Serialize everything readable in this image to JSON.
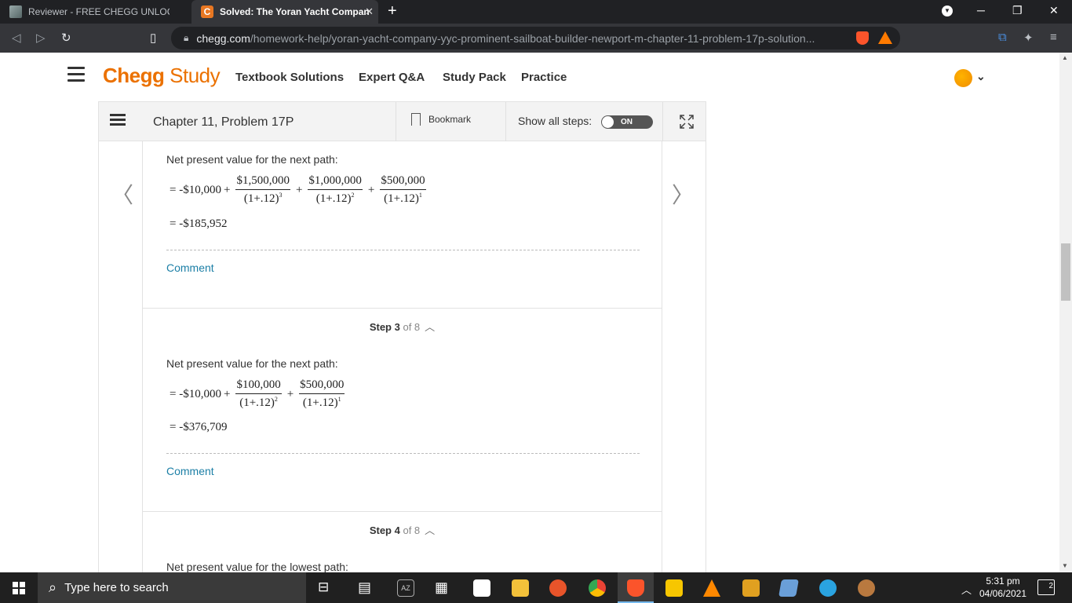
{
  "browser": {
    "tabs": [
      {
        "title": "Reviewer - FREE CHEGG UNLOCKS | Pa",
        "active": false
      },
      {
        "title": "Solved: The Yoran Yacht Company",
        "active": true
      }
    ],
    "url_host": "chegg.com",
    "url_path": "/homework-help/yoran-yacht-company-yyc-prominent-sailboat-builder-newport-m-chapter-11-problem-17p-solution..."
  },
  "header": {
    "logo_main": "Chegg",
    "logo_sub": "Study",
    "nav": [
      "Textbook Solutions",
      "Expert Q&A",
      "Study Pack",
      "Practice"
    ]
  },
  "panel": {
    "chapter_title": "Chapter 11, Problem 17P",
    "bookmark_label": "Bookmark",
    "show_steps_label": "Show all steps:",
    "toggle_label": "ON"
  },
  "steps": {
    "s2": {
      "text": "Net present value for the next path:",
      "lead": "= -$10,000",
      "fracs": [
        {
          "num": "$1,500,000",
          "den": "(1+.12)",
          "exp": "3"
        },
        {
          "num": "$1,000,000",
          "den": "(1+.12)",
          "exp": "2"
        },
        {
          "num": "$500,000",
          "den": "(1+.12)",
          "exp": "1"
        }
      ],
      "result": "= -$185,952",
      "comment": "Comment"
    },
    "s3": {
      "label": "Step 3",
      "of": "of 8",
      "text": "Net present value for the next path:",
      "lead": "= -$10,000",
      "fracs": [
        {
          "num": "$100,000",
          "den": "(1+.12)",
          "exp": "2"
        },
        {
          "num": "$500,000",
          "den": "(1+.12)",
          "exp": "1"
        }
      ],
      "result": "= -$376,709",
      "comment": "Comment"
    },
    "s4": {
      "label": "Step 4",
      "of": "of 8",
      "text": "Net present value for the lowest path:"
    }
  },
  "taskbar": {
    "search_placeholder": "Type here to search",
    "time": "5:31 pm",
    "date": "04/06/2021",
    "notification_count": "2"
  }
}
